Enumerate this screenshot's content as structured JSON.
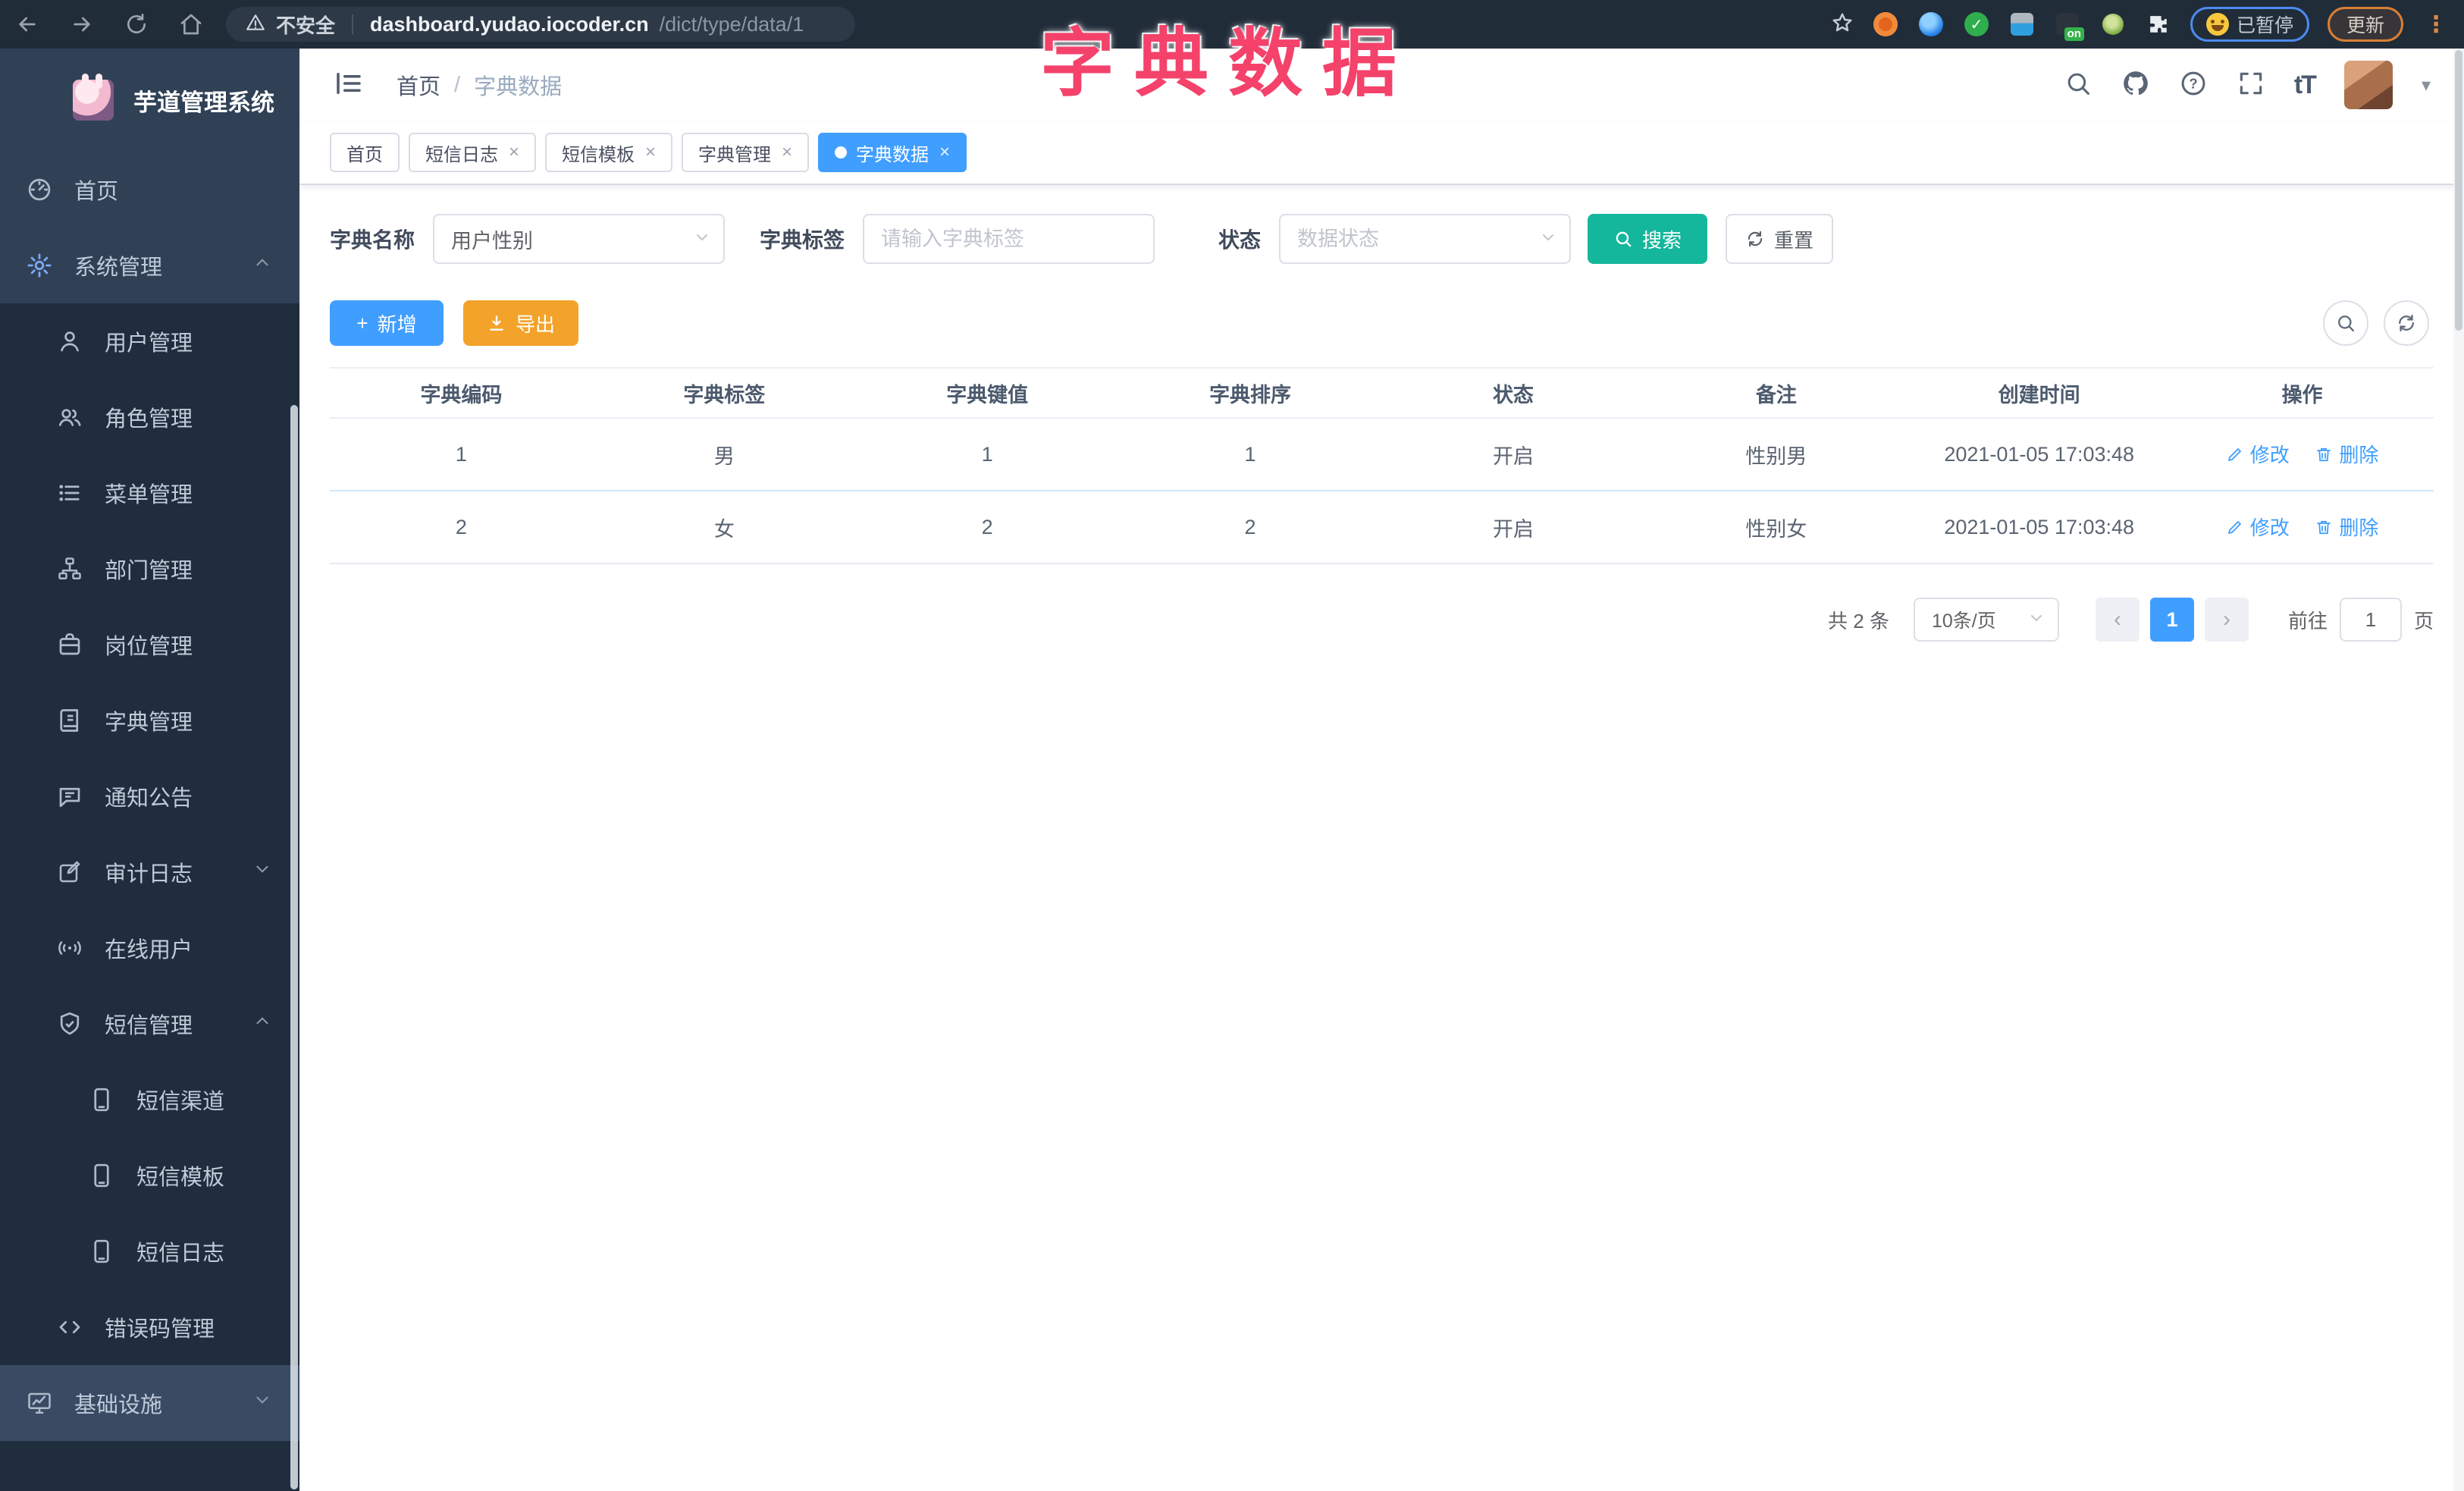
{
  "browser": {
    "security_warning": "不安全",
    "url_host": "dashboard.yudao.iocoder.cn",
    "url_path": "/dict/type/data/1",
    "extension_on_badge": "on",
    "paused_badge": "已暂停",
    "update_button": "更新"
  },
  "overlay_title": "字典数据",
  "icons": {
    "close": "×",
    "more_vertical": "⋮",
    "caret_down": "▾",
    "breadcrumb_separator": "/",
    "question": "?",
    "text_size": "tT",
    "plus": "+",
    "chevron_left": "‹",
    "chevron_right": "›"
  },
  "sidebar": {
    "logo_title": "芋道管理系统",
    "items": [
      {
        "label": "首页"
      },
      {
        "label": "系统管理"
      },
      {
        "label": "用户管理"
      },
      {
        "label": "角色管理"
      },
      {
        "label": "菜单管理"
      },
      {
        "label": "部门管理"
      },
      {
        "label": "岗位管理"
      },
      {
        "label": "字典管理"
      },
      {
        "label": "通知公告"
      },
      {
        "label": "审计日志"
      },
      {
        "label": "在线用户"
      },
      {
        "label": "短信管理"
      },
      {
        "label": "短信渠道"
      },
      {
        "label": "短信模板"
      },
      {
        "label": "短信日志"
      },
      {
        "label": "错误码管理"
      },
      {
        "label": "基础设施"
      }
    ]
  },
  "header": {
    "breadcrumb_home": "首页",
    "breadcrumb_current": "字典数据"
  },
  "tabs": [
    {
      "label": "首页"
    },
    {
      "label": "短信日志"
    },
    {
      "label": "短信模板"
    },
    {
      "label": "字典管理"
    },
    {
      "label": "字典数据"
    }
  ],
  "filters": {
    "dict_name_label": "字典名称",
    "dict_name_value": "用户性别",
    "dict_label_label": "字典标签",
    "dict_label_placeholder": "请输入字典标签",
    "status_label": "状态",
    "status_placeholder": "数据状态",
    "search_button": "搜索",
    "reset_button": "重置"
  },
  "toolbar": {
    "add_label": "新增",
    "export_label": "导出"
  },
  "table": {
    "headers": [
      "字典编码",
      "字典标签",
      "字典键值",
      "字典排序",
      "状态",
      "备注",
      "创建时间",
      "操作"
    ],
    "rows": [
      [
        "1",
        "男",
        "1",
        "1",
        "开启",
        "性别男",
        "2021-01-05 17:03:48"
      ],
      [
        "2",
        "女",
        "2",
        "2",
        "开启",
        "性别女",
        "2021-01-05 17:03:48"
      ]
    ],
    "edit_label": "修改",
    "delete_label": "删除"
  },
  "pagination": {
    "total": "共 2 条",
    "page_size": "10条/页",
    "current_page": "1",
    "goto_label": "前往",
    "goto_value": "1",
    "page_unit": "页"
  },
  "colors": {
    "accent_blue": "#409EFF",
    "search_teal": "#14B79B",
    "export_orange": "#F3A32A",
    "sidebar_bg": "#304156",
    "sidebar_submenu_bg": "#1F2D3D",
    "browser_bar_bg": "#212C39",
    "overlay_pink": "#F4426B"
  }
}
